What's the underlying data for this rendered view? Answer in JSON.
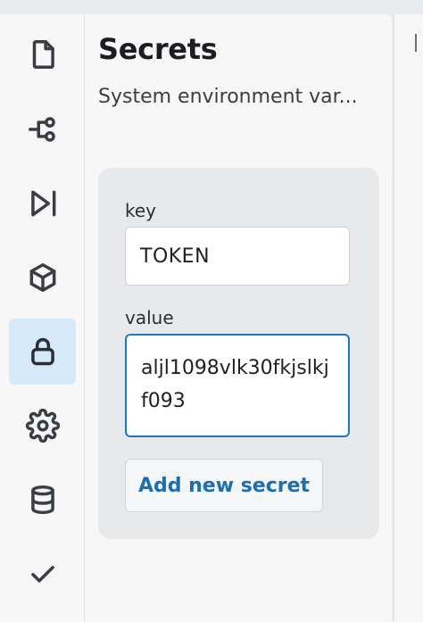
{
  "sidebar": {
    "items": [
      {
        "icon": "file-icon",
        "active": false
      },
      {
        "icon": "connections-icon",
        "active": false
      },
      {
        "icon": "run-icon",
        "active": false
      },
      {
        "icon": "cube-icon",
        "active": false
      },
      {
        "icon": "lock-icon",
        "active": true
      },
      {
        "icon": "gear-icon",
        "active": false
      },
      {
        "icon": "database-icon",
        "active": false
      },
      {
        "icon": "check-icon",
        "active": false
      }
    ]
  },
  "panel": {
    "title": "Secrets",
    "subtitle": "System environment var..."
  },
  "form": {
    "key_label": "key",
    "key_value": "TOKEN",
    "value_label": "value",
    "value_value": "aljl1098vlk30fkjslkjf093",
    "add_button_label": "Add new secret"
  },
  "colors": {
    "accent": "#1a78c8",
    "active_bg": "#d6e9f8",
    "link_text": "#1a6fb4"
  }
}
